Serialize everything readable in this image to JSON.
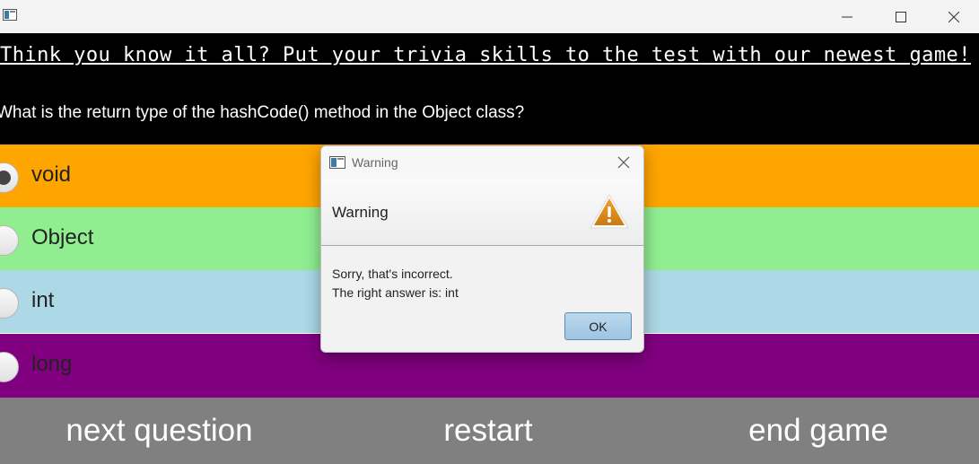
{
  "window": {
    "app_icon": "java-app-icon",
    "controls": [
      "minimize-icon",
      "maximize-icon",
      "close-icon"
    ]
  },
  "header": {
    "headline": "Think you know it all? Put your trivia skills to the test with our newest game!",
    "question": "What is the return type of the hashCode() method in the Object class?"
  },
  "answers": [
    {
      "label": "void",
      "color": "#FFA500",
      "selected": true
    },
    {
      "label": "Object",
      "color": "#90EE90",
      "selected": false
    },
    {
      "label": "int",
      "color": "#ADD8E6",
      "selected": false
    },
    {
      "label": "long",
      "color": "#800080",
      "selected": false
    }
  ],
  "buttons": {
    "next": "next question",
    "restart": "restart",
    "end": "end game",
    "color": "#808080"
  },
  "dialog": {
    "title": "Warning",
    "header_text": "Warning",
    "icon": "warning-triangle-icon",
    "message_line1": "Sorry, that's incorrect.",
    "message_line2": "The right answer is: int",
    "ok_label": "OK"
  }
}
